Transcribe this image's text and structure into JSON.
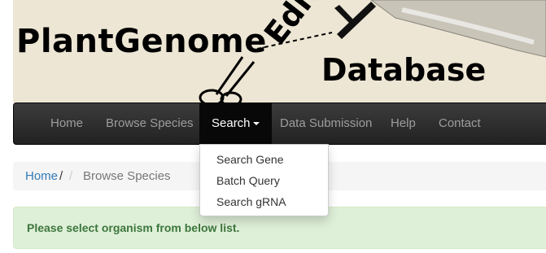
{
  "banner": {
    "word_plant_genome": "PlantGenome",
    "word_editing": "Editing",
    "word_database": "Database"
  },
  "nav": {
    "home": "Home",
    "browse_species": "Browse Species",
    "search": "Search",
    "data_submission": "Data Submission",
    "help": "Help",
    "contact": "Contact"
  },
  "search_menu": {
    "items": [
      "Search Gene",
      "Batch Query",
      "Search gRNA"
    ]
  },
  "breadcrumb": {
    "home": "Home",
    "separator": "/",
    "current": "Browse Species"
  },
  "alert": {
    "message": "Please select organism from below list."
  },
  "colors": {
    "banner_bg": "#ede6d4",
    "navbar_bg": "#222222",
    "link": "#337ab7",
    "alert_bg": "#dff0d8",
    "alert_text": "#3c763d"
  }
}
